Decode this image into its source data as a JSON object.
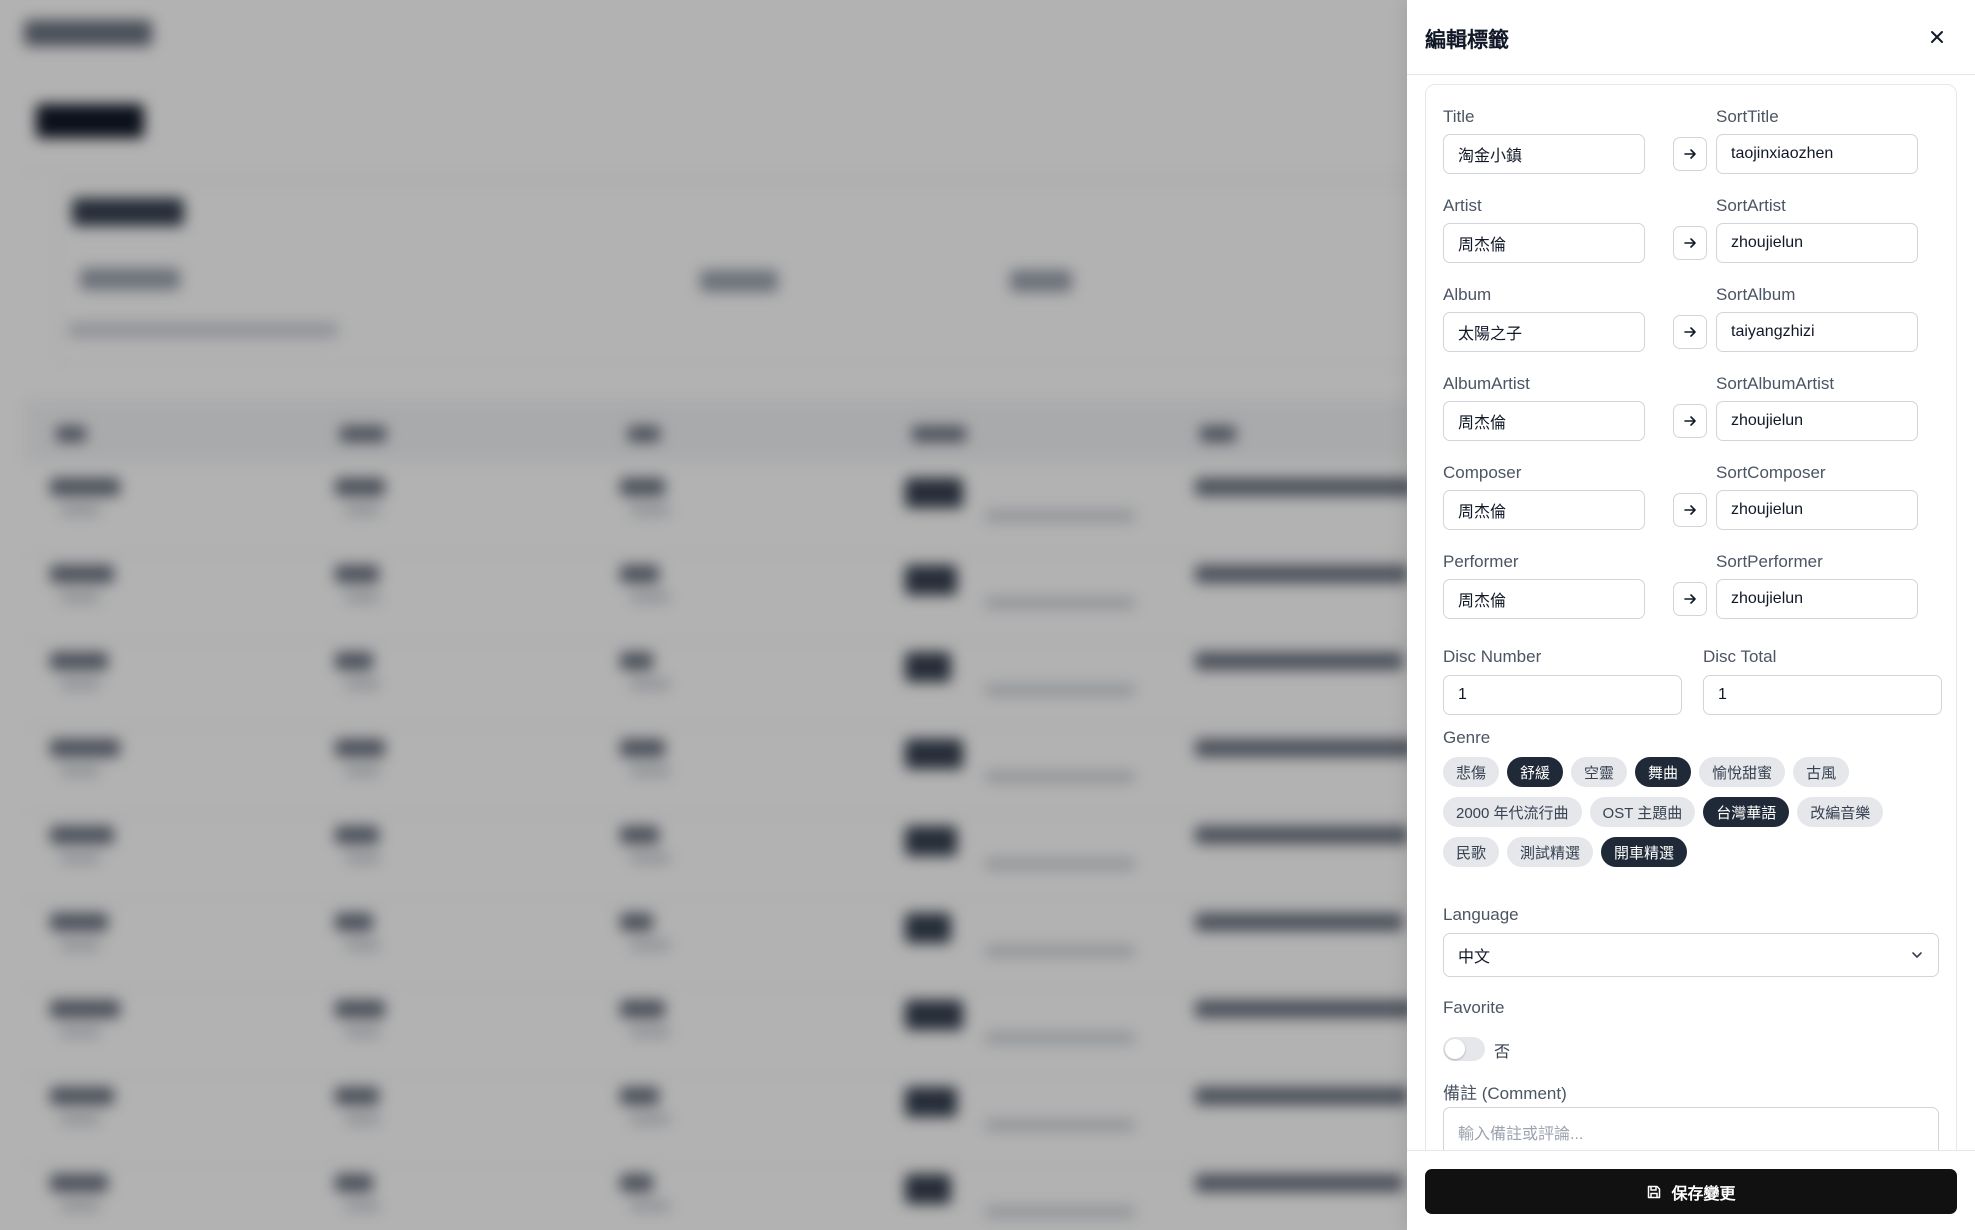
{
  "drawer": {
    "title": "編輯標籤",
    "close_icon": "close-icon"
  },
  "pair_fields": [
    {
      "label": "Title",
      "value": "淘金小鎮",
      "sort_label": "SortTitle",
      "sort_value": "taojinxiaozhen"
    },
    {
      "label": "Artist",
      "value": "周杰倫",
      "sort_label": "SortArtist",
      "sort_value": "zhoujielun"
    },
    {
      "label": "Album",
      "value": "太陽之子",
      "sort_label": "SortAlbum",
      "sort_value": "taiyangzhizi"
    },
    {
      "label": "AlbumArtist",
      "value": "周杰倫",
      "sort_label": "SortAlbumArtist",
      "sort_value": "zhoujielun"
    },
    {
      "label": "Composer",
      "value": "周杰倫",
      "sort_label": "SortComposer",
      "sort_value": "zhoujielun"
    },
    {
      "label": "Performer",
      "value": "周杰倫",
      "sort_label": "SortPerformer",
      "sort_value": "zhoujielun"
    }
  ],
  "disc": {
    "number_label": "Disc Number",
    "number_value": "1",
    "total_label": "Disc Total",
    "total_value": "1"
  },
  "genre": {
    "label": "Genre",
    "rows": [
      [
        {
          "label": "悲傷",
          "selected": false
        },
        {
          "label": "舒緩",
          "selected": true
        },
        {
          "label": "空靈",
          "selected": false
        },
        {
          "label": "舞曲",
          "selected": true
        },
        {
          "label": "愉悅甜蜜",
          "selected": false
        },
        {
          "label": "古風",
          "selected": false
        }
      ],
      [
        {
          "label": "2000 年代流行曲",
          "selected": false
        },
        {
          "label": "OST 主題曲",
          "selected": false
        },
        {
          "label": "台灣華語",
          "selected": true
        },
        {
          "label": "改編音樂",
          "selected": false
        }
      ],
      [
        {
          "label": "民歌",
          "selected": false
        },
        {
          "label": "測試精選",
          "selected": false
        },
        {
          "label": "開車精選",
          "selected": true
        }
      ]
    ]
  },
  "language": {
    "label": "Language",
    "value": "中文",
    "icon": "chevron-down-icon"
  },
  "favorite": {
    "label": "Favorite",
    "state_text": "否",
    "checked": false
  },
  "comment": {
    "label": "備註 (Comment)",
    "placeholder": "輸入備註或評論..."
  },
  "footer": {
    "save_label": "保存變更",
    "save_icon": "save-icon"
  },
  "colors": {
    "chip_selected": "#1f2937",
    "chip_unselected": "#e5e7eb",
    "save_button": "#111111",
    "overlay": "rgba(0,0,0,0.30)"
  }
}
